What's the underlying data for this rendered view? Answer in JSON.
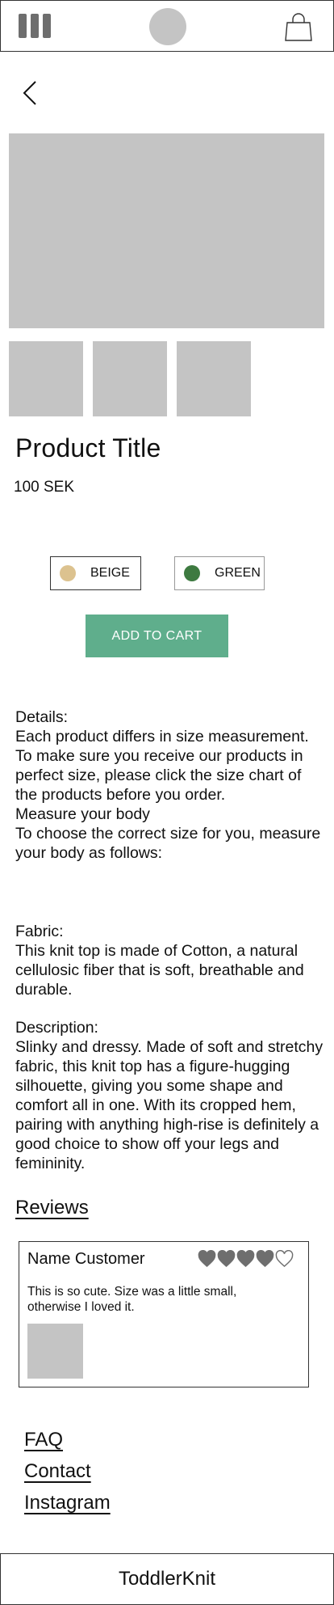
{
  "header": {
    "menu_icon": "menu-icon",
    "logo": "logo-placeholder",
    "cart_icon": "shopping-bag-icon"
  },
  "nav": {
    "back_icon": "chevron-left-icon"
  },
  "product": {
    "title": "Product Title",
    "price": "100 SEK",
    "colors": [
      {
        "label": "BEIGE",
        "hex": "#dcc28f"
      },
      {
        "label": "GREEN",
        "hex": "#3d7a40"
      }
    ],
    "add_to_cart": "ADD TO CART"
  },
  "details": {
    "lines": [
      "Details:",
      "Each product differs in size measurement.",
      "To make sure you receive our products in perfect size, please click the size chart of the products before you order.",
      "Measure your body",
      "To choose the correct size for you, measure your body as follows:"
    ]
  },
  "fabric": {
    "heading": "Fabric:",
    "text": "This knit top is made of Cotton, a natural cellulosic fiber that is soft, breathable and durable."
  },
  "description": {
    "heading": "Description:",
    "text": "Slinky and dressy. Made of soft and stretchy fabric, this knit top has a figure-hugging silhouette, giving you some shape and comfort all in one. With its cropped hem, pairing with anything high-rise is definitely a good choice to show off your legs and femininity."
  },
  "reviews": {
    "heading": "Reviews",
    "items": [
      {
        "name": "Name Customer",
        "rating": 4,
        "max_rating": 5,
        "text": "This is so cute. Size was a little small, otherwise I loved it."
      }
    ]
  },
  "footer": {
    "links": [
      "FAQ",
      "Contact",
      "Instagram"
    ],
    "brand": "ToddlerKnit"
  },
  "colors": {
    "accent": "#5fae8c",
    "placeholder": "#c4c4c4",
    "star": "#6e6e6e"
  }
}
